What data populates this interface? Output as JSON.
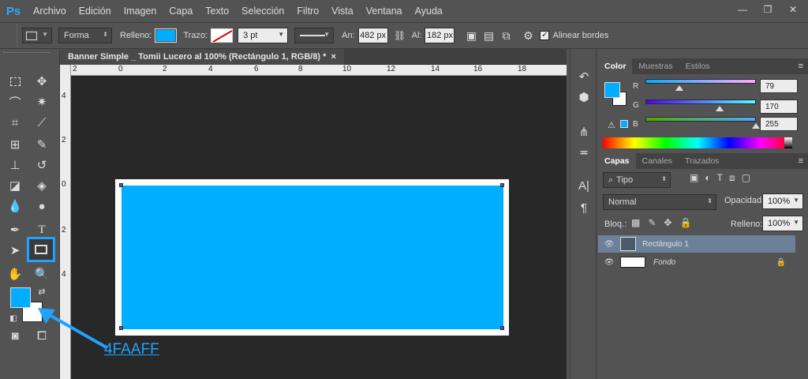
{
  "app": {
    "logo": "Ps",
    "accent": "#31a8ff"
  },
  "menu": [
    "Archivo",
    "Edición",
    "Imagen",
    "Capa",
    "Texto",
    "Selección",
    "Filtro",
    "Vista",
    "Ventana",
    "Ayuda"
  ],
  "window_buttons": {
    "minimize": "—",
    "restore": "❐",
    "close": "✕"
  },
  "options_bar": {
    "mode": "Forma",
    "fill_label": "Relleno:",
    "fill_color": "#00aeff",
    "stroke_label": "Trazo:",
    "stroke_width": "3 pt",
    "width_label": "An:",
    "width_value": "482 px",
    "height_label": "Al:",
    "height_value": "182 px",
    "align_edges_label": "Alinear bordes",
    "align_edges_checked": true
  },
  "document": {
    "tab_title": "Banner Simple _ Tomii Lucero al 100% (Rectángulo 1, RGB/8) *",
    "tab_close": "×",
    "ruler_top_labels": [
      "2",
      "0",
      "2",
      "4",
      "6",
      "8",
      "10",
      "12",
      "14",
      "16",
      "18"
    ],
    "ruler_left_labels": [
      "4",
      "2",
      "0",
      "2",
      "4"
    ],
    "canvas_bg": "#282828",
    "shape_color": "#00aeff"
  },
  "annotation": {
    "text": "4FAAFF",
    "color": "#1fa3ff"
  },
  "colors": {
    "foreground": "#00aeff",
    "background": "#ffffff"
  },
  "color_panel": {
    "tabs": [
      "Color",
      "Muestras",
      "Estilos"
    ],
    "active_tab": "Color",
    "r_label": "R",
    "g_label": "G",
    "b_label": "B",
    "r": "79",
    "g": "170",
    "b": "255",
    "r_fraction": 0.31,
    "g_fraction": 0.67,
    "b_fraction": 1.0
  },
  "layers_panel": {
    "tabs": [
      "Capas",
      "Canales",
      "Trazados"
    ],
    "active_tab": "Capas",
    "filter": "Tipo",
    "blend_mode": "Normal",
    "opacity_label": "Opacidad:",
    "opacity": "100%",
    "lock_label": "Bloq.:",
    "fill_label": "Relleno:",
    "fill": "100%",
    "layers": [
      {
        "name": "Rectángulo 1",
        "selected": true
      },
      {
        "name": "Fondo",
        "selected": false,
        "locked": true
      }
    ]
  }
}
